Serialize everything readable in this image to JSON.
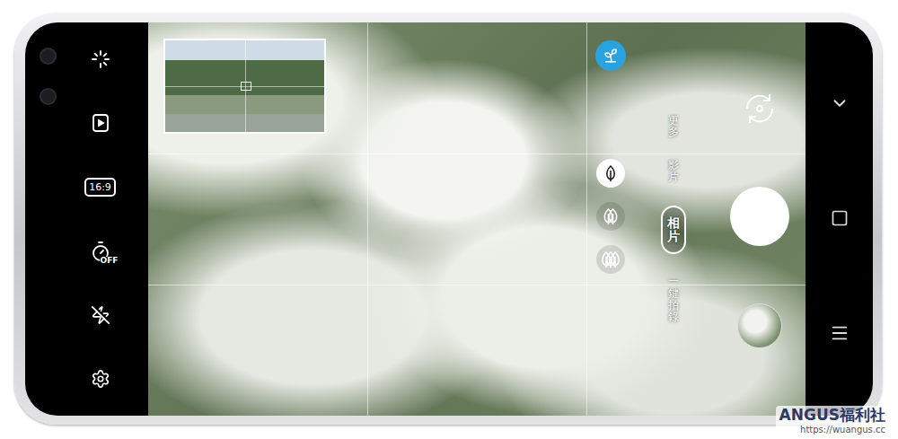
{
  "left_toolbar": {
    "aspect_ratio": "16:9",
    "timer": "OFF"
  },
  "scene_optimizer": {
    "on": true
  },
  "zoom_levels": [
    {
      "selected": true
    },
    {
      "selected": false
    },
    {
      "selected": false
    }
  ],
  "modes": [
    {
      "label": "更多",
      "selected": false
    },
    {
      "label": "影片",
      "selected": false
    },
    {
      "label": "相片",
      "selected": true
    },
    {
      "label": "一鍵拍錄",
      "selected": false
    }
  ],
  "watermark": {
    "brand": "ANGUS福利社",
    "url": "https://wuangus.cc"
  }
}
